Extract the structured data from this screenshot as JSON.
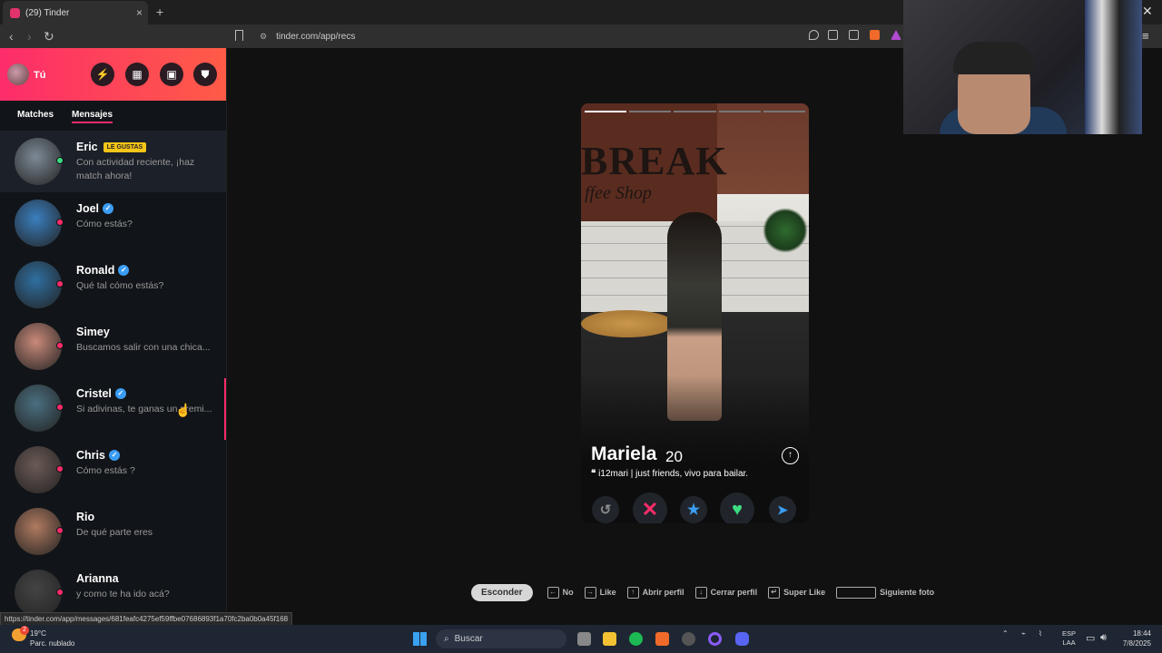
{
  "browser": {
    "tab_title": "(29) Tinder",
    "tab_close": "×",
    "new_tab": "+",
    "url": "tinder.com/app/recs",
    "back": "‹",
    "forward": "›",
    "reload": "↻",
    "status_url": "https://tinder.com/app/messages/681feafc4275ef59ffbe07686893f1a70fc2ba0b0a45f168",
    "close_window": "✕",
    "menu": "≡"
  },
  "sidebar": {
    "me_label": "Tú",
    "header_icons": [
      "bolt-icon",
      "explore-icon",
      "briefcase-icon",
      "shield-icon"
    ],
    "tabs": [
      "Matches",
      "Mensajes"
    ],
    "active_tab": "Mensajes",
    "conversations": [
      {
        "name": "Eric",
        "badge": "LE GUSTAS",
        "message": "Con actividad reciente, ¡haz match ahora!",
        "verified": false,
        "online": true
      },
      {
        "name": "Joel",
        "message": "Cómo estás?",
        "verified": true
      },
      {
        "name": "Ronald",
        "message": "Qué tal cómo estás?",
        "verified": true
      },
      {
        "name": "Simey",
        "message": "Buscamos salir con una chica...",
        "verified": false
      },
      {
        "name": "Cristel",
        "message": "Si adivinas, te ganas un premi...",
        "verified": true
      },
      {
        "name": "Chris",
        "message": "Cómo estás ?",
        "verified": true
      },
      {
        "name": "Rio",
        "message": "De qué parte eres",
        "verified": false
      },
      {
        "name": "Arianna",
        "message": "y como te ha ido acá?",
        "verified": false
      }
    ]
  },
  "card": {
    "name": "Mariela",
    "age": "20",
    "bio": "i12mari | just friends, vivo para bailar.",
    "photo_count": 5,
    "active_photo": 0,
    "photo_sign_big": "BREAK",
    "photo_sign_small": "ffee Shop",
    "info": "↑",
    "buttons": {
      "rewind": "↺",
      "nope": "✕",
      "super": "★",
      "like": "♥",
      "boost": "➤"
    }
  },
  "shortcuts": {
    "hide": "Esconder",
    "items": [
      {
        "key": "←",
        "label": "No"
      },
      {
        "key": "→",
        "label": "Like"
      },
      {
        "key": "↑",
        "label": "Abrir perfil"
      },
      {
        "key": "↓",
        "label": "Cerrar perfil"
      },
      {
        "key": "↵",
        "label": "Super Like"
      },
      {
        "key": "",
        "label": "Siguiente foto"
      }
    ]
  },
  "taskbar": {
    "temp": "19°C",
    "weather": "Parc. nublado",
    "search": "Buscar",
    "lang1": "ESP",
    "lang2": "LAA",
    "time": "18:44",
    "date": "7/8/2025",
    "notif_count": "2"
  },
  "colors": {
    "brand": "#fd2c6a",
    "brand2": "#ff5c47",
    "like": "#3ddc84",
    "super": "#3b9cf3",
    "badge": "#f5c518"
  }
}
